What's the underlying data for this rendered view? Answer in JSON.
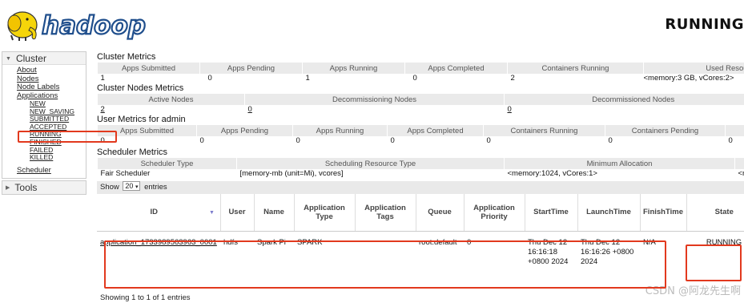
{
  "header": {
    "logo_text": "hadoop",
    "page_state": "RUNNING"
  },
  "sidebar": {
    "cluster_label": "Cluster",
    "links": [
      "About",
      "Nodes",
      "Node Labels",
      "Applications"
    ],
    "app_states": [
      "NEW",
      "NEW_SAVING",
      "SUBMITTED",
      "ACCEPTED",
      "RUNNING",
      "FINISHED",
      "FAILED",
      "KILLED"
    ],
    "scheduler": "Scheduler",
    "tools_label": "Tools"
  },
  "cluster_metrics": {
    "title": "Cluster Metrics",
    "headers": [
      "Apps Submitted",
      "Apps Pending",
      "Apps Running",
      "Apps Completed",
      "Containers Running",
      "Used Resources"
    ],
    "values": [
      "1",
      "0",
      "1",
      "0",
      "2",
      "<memory:3 GB, vCores:2>"
    ]
  },
  "node_metrics": {
    "title": "Cluster Nodes Metrics",
    "headers": [
      "Active Nodes",
      "Decommissioning Nodes",
      "Decommissioned Nodes"
    ],
    "values": [
      "2",
      "0",
      "0"
    ]
  },
  "user_metrics": {
    "title": "User Metrics for admin",
    "headers": [
      "Apps Submitted",
      "Apps Pending",
      "Apps Running",
      "Apps Completed",
      "Containers Running",
      "Containers Pending"
    ],
    "values": [
      "0",
      "0",
      "0",
      "0",
      "0",
      "0",
      "0"
    ]
  },
  "scheduler_metrics": {
    "title": "Scheduler Metrics",
    "headers": [
      "Scheduler Type",
      "Scheduling Resource Type",
      "Minimum Allocation"
    ],
    "values": [
      "Fair Scheduler",
      "[memory-mb (unit=Mi), vcores]",
      "<memory:1024, vCores:1>",
      "<m"
    ]
  },
  "apps_table": {
    "show_label": "Show",
    "page_size": "20",
    "entries_label": "entries",
    "headers": [
      "ID",
      "User",
      "Name",
      "Application Type",
      "Application Tags",
      "Queue",
      "Application Priority",
      "StartTime",
      "LaunchTime",
      "FinishTime",
      "State"
    ],
    "row": {
      "id": "application_1733989563963_0001",
      "user": "hdfs",
      "name": "Spark Pi",
      "type": "SPARK",
      "tags": "",
      "queue": "root.default",
      "priority": "0",
      "start": "Thu Dec 12 16:16:18 +0800 2024",
      "launch": "Thu Dec 12 16:16:26 +0800 2024",
      "finish": "N/A",
      "state": "RUNNING"
    },
    "footer": "Showing 1 to 1 of 1 entries"
  },
  "watermark": "CSDN @阿龙先生啊",
  "colors": {
    "highlight": "#e2391e",
    "header_bg": "#eaeaea",
    "logo_yellow": "#f5d50a",
    "logo_blue": "#1f4e8c"
  }
}
